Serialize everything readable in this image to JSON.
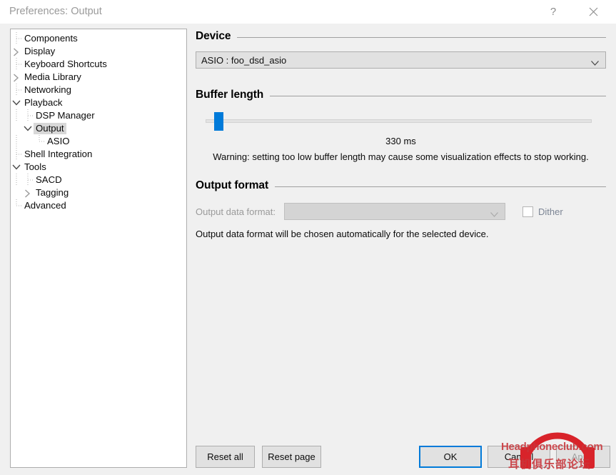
{
  "window": {
    "title": "Preferences: Output",
    "help_icon": "question-mark-icon",
    "close_icon": "close-icon"
  },
  "sidebar": {
    "items": [
      {
        "label": "Components",
        "depth": 0,
        "marker": "leaf",
        "selected": false
      },
      {
        "label": "Display",
        "depth": 0,
        "marker": "collapsed",
        "selected": false
      },
      {
        "label": "Keyboard Shortcuts",
        "depth": 0,
        "marker": "leaf",
        "selected": false
      },
      {
        "label": "Media Library",
        "depth": 0,
        "marker": "collapsed",
        "selected": false
      },
      {
        "label": "Networking",
        "depth": 0,
        "marker": "leaf",
        "selected": false
      },
      {
        "label": "Playback",
        "depth": 0,
        "marker": "expanded",
        "selected": false
      },
      {
        "label": "DSP Manager",
        "depth": 1,
        "marker": "leaf",
        "selected": false
      },
      {
        "label": "Output",
        "depth": 1,
        "marker": "expanded",
        "selected": true
      },
      {
        "label": "ASIO",
        "depth": 2,
        "marker": "leaf-last",
        "selected": false
      },
      {
        "label": "Shell Integration",
        "depth": 0,
        "marker": "leaf",
        "selected": false
      },
      {
        "label": "Tools",
        "depth": 0,
        "marker": "expanded",
        "selected": false
      },
      {
        "label": "SACD",
        "depth": 1,
        "marker": "leaf",
        "selected": false
      },
      {
        "label": "Tagging",
        "depth": 1,
        "marker": "collapsed",
        "selected": false
      },
      {
        "label": "Advanced",
        "depth": 0,
        "marker": "leaf-last",
        "selected": false
      }
    ]
  },
  "main": {
    "device": {
      "group_title": "Device",
      "selected_value": "ASIO : foo_dsd_asio",
      "dropdown_icon": "chevron-down-icon"
    },
    "buffer": {
      "group_title": "Buffer length",
      "value_text": "330 ms",
      "warning": "Warning: setting too low buffer length may cause some visualization effects to stop working.",
      "slider_percent": 1,
      "accent_color": "#007ad9"
    },
    "output_format": {
      "group_title": "Output format",
      "data_format_label": "Output data format:",
      "data_format_value": "",
      "dropdown_icon": "chevron-down-icon",
      "dither_label": "Dither",
      "dither_checked": false,
      "note": "Output data format will be chosen automatically for the selected device."
    }
  },
  "buttons": {
    "reset_all": "Reset all",
    "reset_page": "Reset page",
    "ok": "OK",
    "cancel": "Cancel",
    "apply": "Apply"
  },
  "watermark": {
    "line1": "Headphoneclub.com",
    "line2": "耳机俱乐部论坛",
    "color": "#c9353a"
  }
}
